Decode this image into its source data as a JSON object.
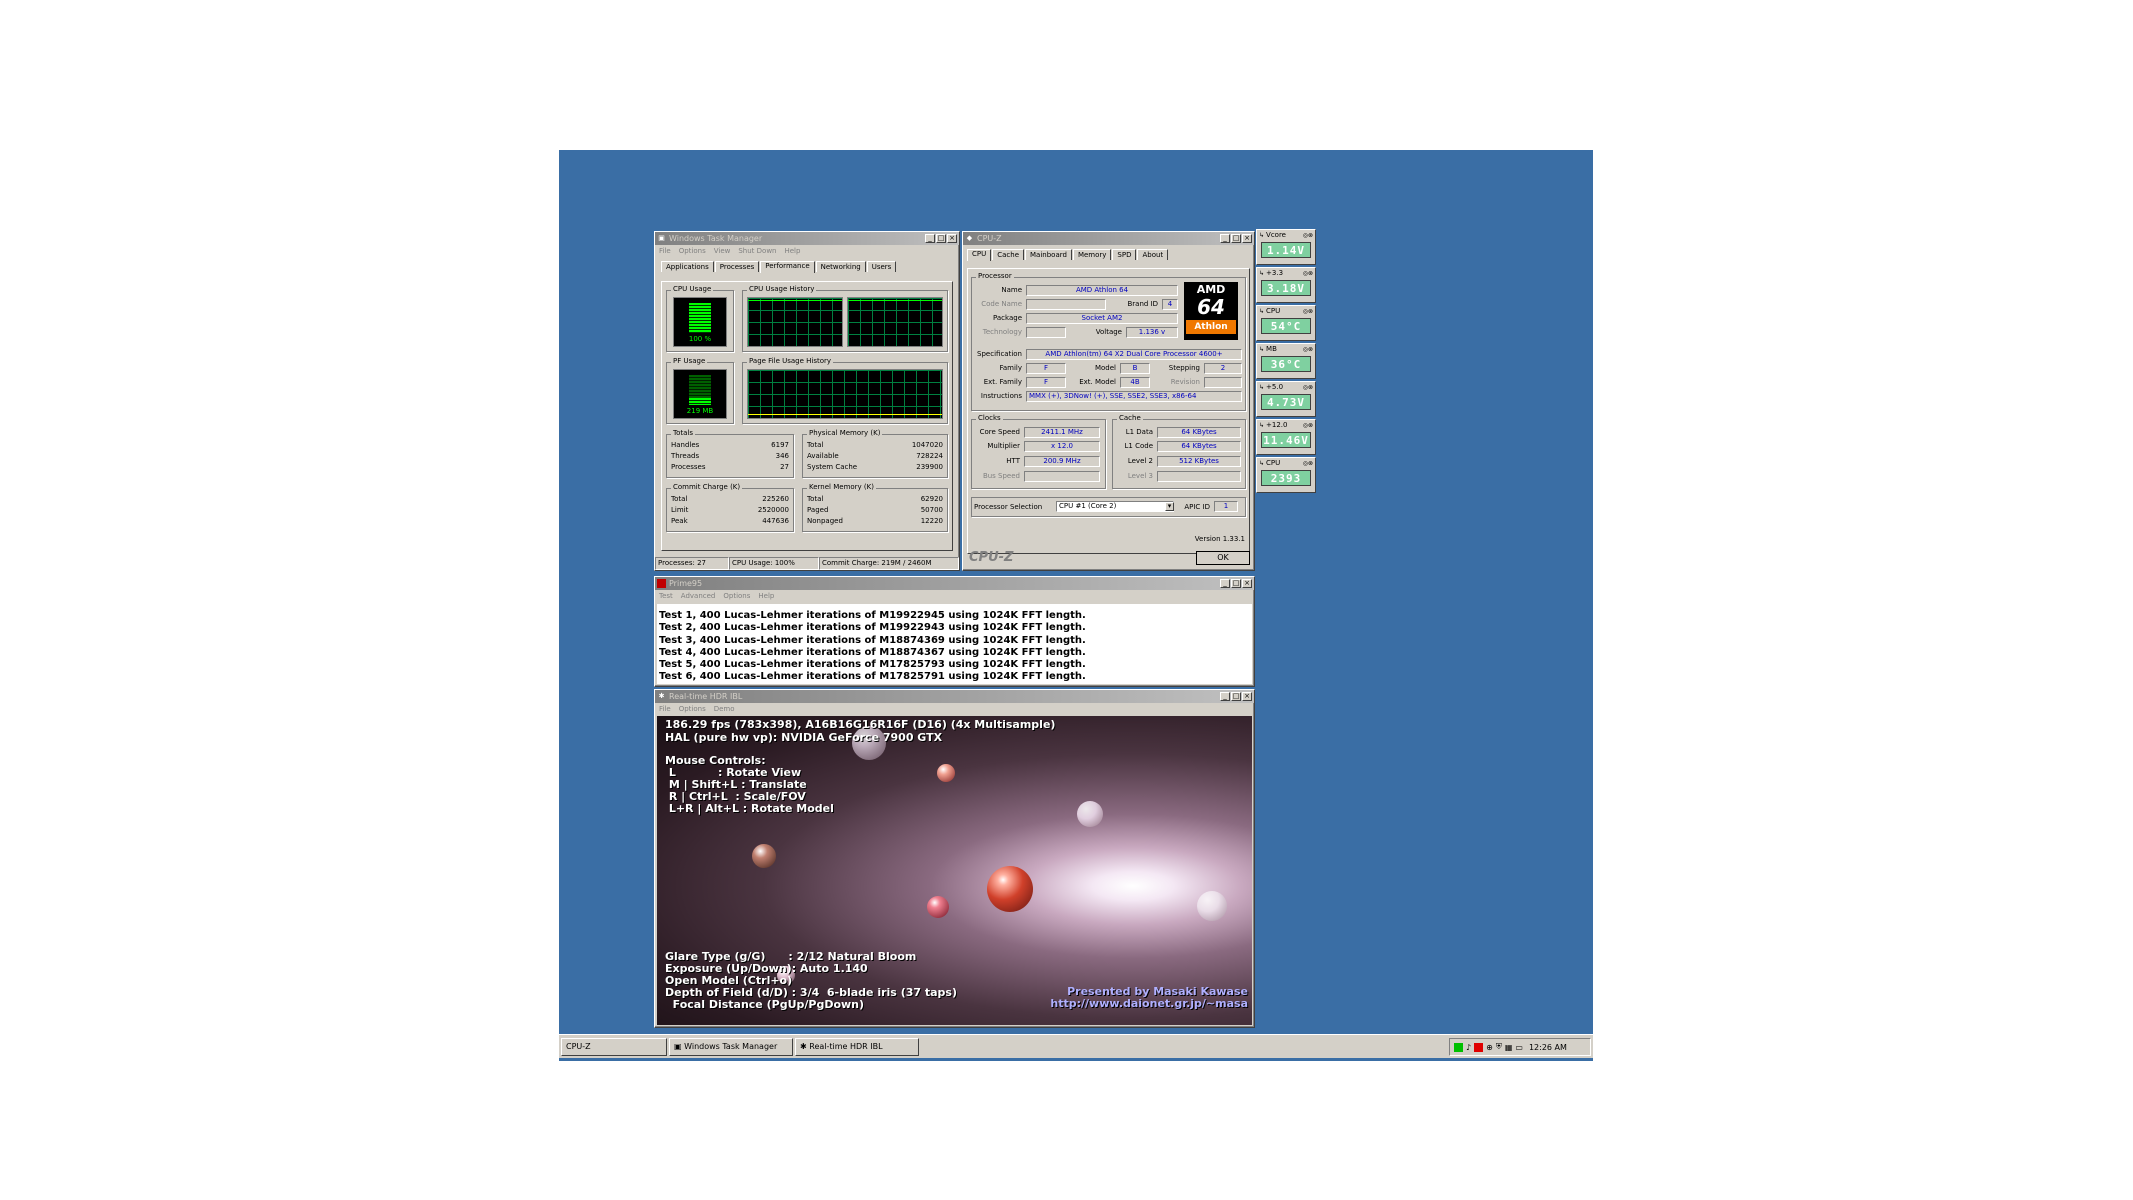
{
  "taskmgr": {
    "title": "Windows Task Manager",
    "menu": [
      "File",
      "Options",
      "View",
      "Shut Down",
      "Help"
    ],
    "tabs": [
      "Applications",
      "Processes",
      "Performance",
      "Networking",
      "Users"
    ],
    "cpu_usage_label": "CPU Usage",
    "cpu_usage_value": "100 %",
    "cpu_history_label": "CPU Usage History",
    "pf_usage_label": "PF Usage",
    "pf_usage_value": "219 MB",
    "pf_history_label": "Page File Usage History",
    "totals": {
      "title": "Totals",
      "rows": [
        [
          "Handles",
          "6197"
        ],
        [
          "Threads",
          "346"
        ],
        [
          "Processes",
          "27"
        ]
      ]
    },
    "physical": {
      "title": "Physical Memory (K)",
      "rows": [
        [
          "Total",
          "1047020"
        ],
        [
          "Available",
          "728224"
        ],
        [
          "System Cache",
          "239900"
        ]
      ]
    },
    "commit": {
      "title": "Commit Charge (K)",
      "rows": [
        [
          "Total",
          "225260"
        ],
        [
          "Limit",
          "2520000"
        ],
        [
          "Peak",
          "447636"
        ]
      ]
    },
    "kernel": {
      "title": "Kernel Memory (K)",
      "rows": [
        [
          "Total",
          "62920"
        ],
        [
          "Paged",
          "50700"
        ],
        [
          "Nonpaged",
          "12220"
        ]
      ]
    },
    "status": [
      "Processes: 27",
      "CPU Usage: 100%",
      "Commit Charge: 219M / 2460M"
    ]
  },
  "cpuz": {
    "title": "CPU-Z",
    "tabs": [
      "CPU",
      "Cache",
      "Mainboard",
      "Memory",
      "SPD",
      "About"
    ],
    "processor_group": "Processor",
    "name_label": "Name",
    "name": "AMD Athlon 64",
    "codename_label": "Code Name",
    "brandid_label": "Brand ID",
    "brandid": "4",
    "package_label": "Package",
    "package": "Socket AM2",
    "technology_label": "Technology",
    "voltage_label": "Voltage",
    "voltage": "1.136 v",
    "spec_label": "Specification",
    "spec": "AMD Athlon(tm) 64 X2 Dual Core Processor 4600+",
    "family_label": "Family",
    "family": "F",
    "model_label": "Model",
    "model": "B",
    "stepping_label": "Stepping",
    "stepping": "2",
    "extfamily_label": "Ext. Family",
    "extfamily": "F",
    "extmodel_label": "Ext. Model",
    "extmodel": "4B",
    "revision_label": "Revision",
    "instr_label": "Instructions",
    "instructions": "MMX (+), 3DNow! (+), SSE, SSE2, SSE3, x86-64",
    "clocks_group": "Clocks",
    "corespeed_label": "Core Speed",
    "corespeed": "2411.1 MHz",
    "multiplier_label": "Multiplier",
    "multiplier": "x 12.0",
    "htt_label": "HTT",
    "htt": "200.9 MHz",
    "busspeed_label": "Bus Speed",
    "cache_group": "Cache",
    "l1data_label": "L1 Data",
    "l1data": "64 KBytes",
    "l1code_label": "L1 Code",
    "l1code": "64 KBytes",
    "level2_label": "Level 2",
    "level2": "512 KBytes",
    "level3_label": "Level 3",
    "procsel_label": "Processor Selection",
    "procsel": "CPU #1 (Core 2)",
    "apic_label": "APIC ID",
    "apic": "1",
    "version": "Version 1.33.1",
    "brand": "CPU-Z",
    "ok": "OK",
    "logo_amd": "AMD",
    "logo_64": "64",
    "logo_athlon": "Athlon"
  },
  "gadgets": [
    {
      "name": "Vcore",
      "value": "1.14V"
    },
    {
      "name": "+3.3",
      "value": "3.18V"
    },
    {
      "name": "CPU",
      "value": "54°C"
    },
    {
      "name": "MB",
      "value": "36°C"
    },
    {
      "name": "+5.0",
      "value": "4.73V"
    },
    {
      "name": "+12.0",
      "value": "11.46V"
    },
    {
      "name": "CPU",
      "value": "2393"
    }
  ],
  "prime95": {
    "title": "Prime95",
    "menu": [
      "Test",
      "Advanced",
      "Options",
      "Help"
    ],
    "lines": [
      "Test 1, 400 Lucas-Lehmer iterations of M19922945 using 1024K FFT length.",
      "Test 2, 400 Lucas-Lehmer iterations of M19922943 using 1024K FFT length.",
      "Test 3, 400 Lucas-Lehmer iterations of M18874369 using 1024K FFT length.",
      "Test 4, 400 Lucas-Lehmer iterations of M18874367 using 1024K FFT length.",
      "Test 5, 400 Lucas-Lehmer iterations of M17825793 using 1024K FFT length.",
      "Test 6, 400 Lucas-Lehmer iterations of M17825791 using 1024K FFT length."
    ]
  },
  "hdr": {
    "title": "Real-time HDR IBL",
    "menu": [
      "File",
      "Options",
      "Demo"
    ],
    "line1": "186.29 fps (783x398), A16B16G16R16F (D16) (4x Multisample)",
    "line2": "HAL (pure hw vp): NVIDIA GeForce 7900 GTX",
    "mouse_title": "Mouse Controls:",
    "mouse": [
      " L           : Rotate View",
      " M | Shift+L : Translate",
      " R | Ctrl+L  : Scale/FOV",
      " L+R | Alt+L : Rotate Model"
    ],
    "bottom": [
      "Glare Type (g/G)      : 2/12 Natural Bloom",
      "Exposure (Up/Down): Auto 1.140",
      "Open Model (Ctrl+o)",
      "Depth of Field (d/D) : 3/4  6-blade iris (37 taps)",
      "  Focal Distance (PgUp/PgDown)"
    ],
    "credit1": "Presented by Masaki Kawase",
    "credit2": "http://www.daionet.gr.jp/~masa"
  },
  "taskbar": {
    "buttons": [
      "CPU-Z",
      "Windows Task Manager",
      "Real-time HDR IBL"
    ],
    "clock": "12:26 AM"
  }
}
